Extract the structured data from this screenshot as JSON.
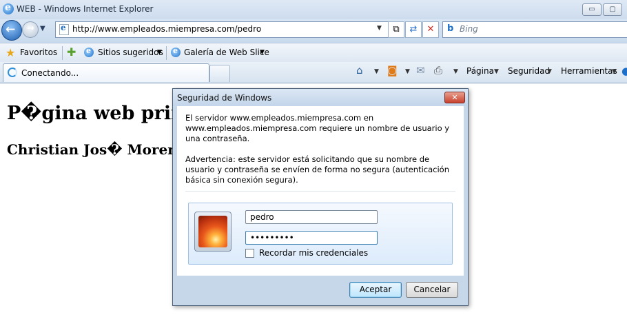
{
  "window": {
    "title": "WEB - Windows Internet Explorer",
    "minimize": "▭",
    "maximize": "▢"
  },
  "navbar": {
    "address": "http://www.empleados.miempresa.com/pedro",
    "search_placeholder": "Bing",
    "back_glyph": "←",
    "forward_glyph": "→"
  },
  "favbar": {
    "favorites_label": "Favoritos",
    "suggested_label": "Sitios sugeridos",
    "webslice_label": "Galería de Web Slice"
  },
  "tabbar": {
    "tab_label": "Conectando...",
    "page_menu": "Página",
    "security_menu": "Seguridad",
    "tools_menu": "Herramientas"
  },
  "page": {
    "heading": "P�gina web princ",
    "subheading": "Christian Jos�  Moreno"
  },
  "dialog": {
    "title": "Seguridad de Windows",
    "message1": "El servidor www.empleados.miempresa.com en www.empleados.miempresa.com requiere un nombre de usuario y una contraseña.",
    "message2": "Advertencia: este servidor está solicitando que su nombre de usuario y contraseña se envíen de forma no segura (autenticación básica sin conexión segura).",
    "username": "pedro",
    "password": "•••••••••",
    "remember_label": "Recordar mis credenciales",
    "ok_label": "Aceptar",
    "cancel_label": "Cancelar",
    "close_glyph": "✕"
  }
}
